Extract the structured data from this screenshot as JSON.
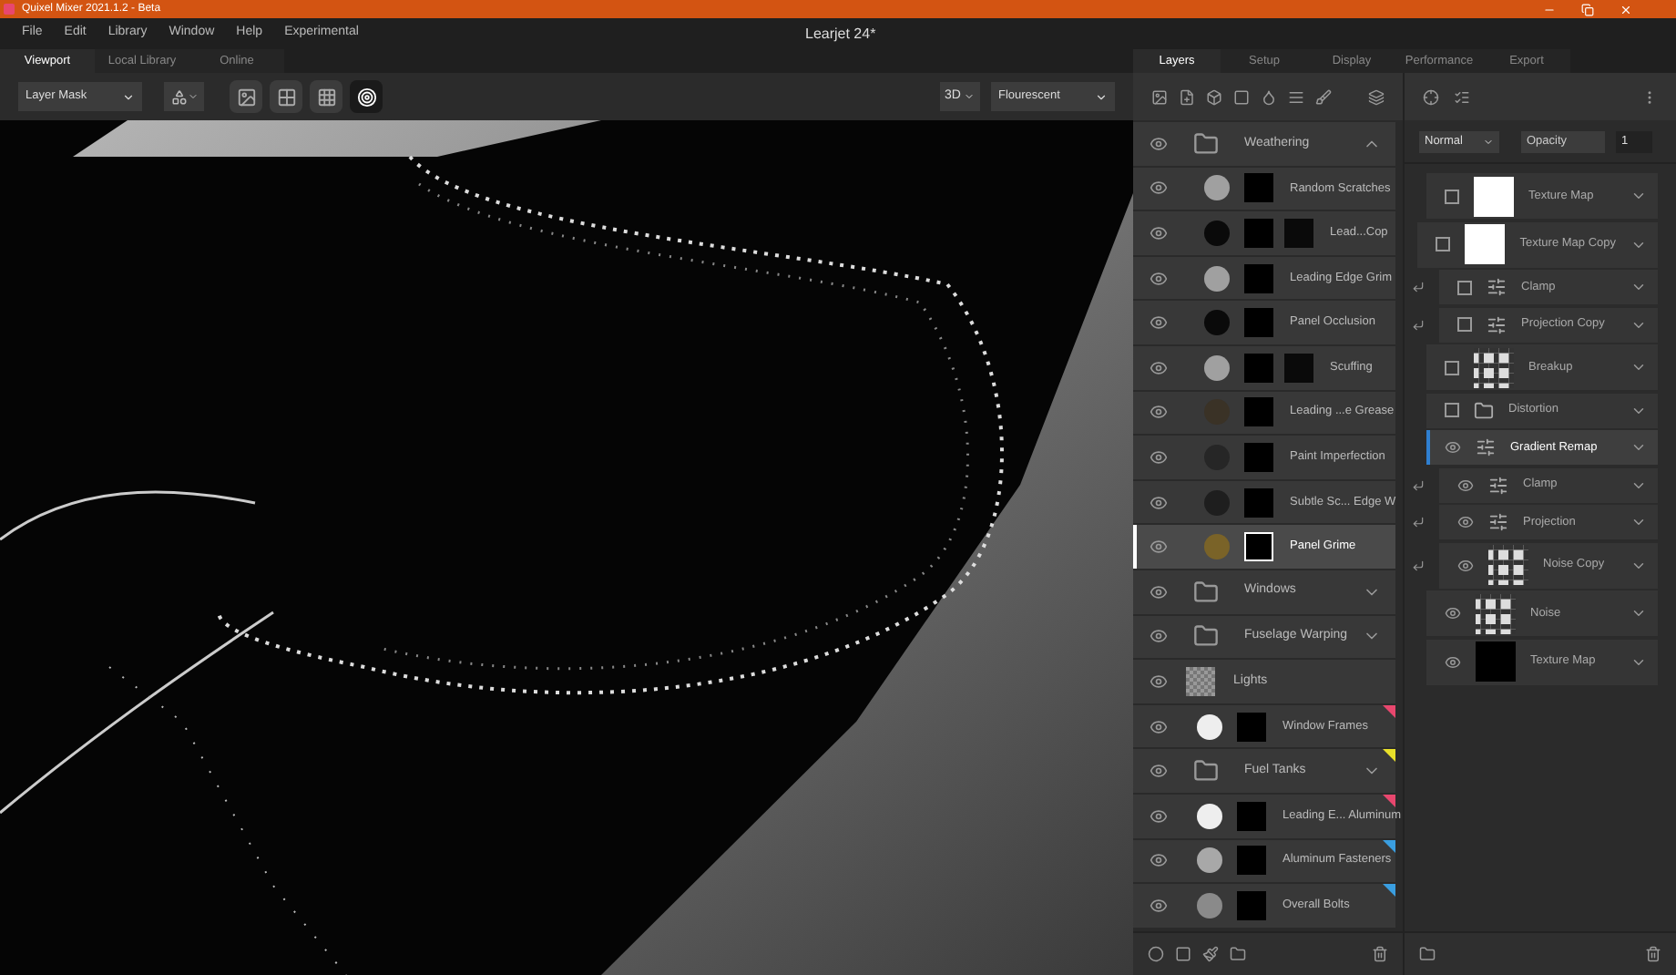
{
  "window": {
    "title": "Quixel Mixer 2021.1.2 - Beta",
    "document": "Learjet 24*"
  },
  "menu": [
    "File",
    "Edit",
    "Library",
    "Window",
    "Help",
    "Experimental"
  ],
  "left_tabs": [
    {
      "label": "Viewport",
      "selected": true
    },
    {
      "label": "Local Library",
      "selected": false
    },
    {
      "label": "Online",
      "selected": false
    }
  ],
  "toolbar": {
    "mode": "Layer Mask",
    "view": "3D",
    "lighting": "Flourescent"
  },
  "panel_tabs": [
    {
      "label": "Layers",
      "selected": true
    },
    {
      "label": "Setup",
      "selected": false
    },
    {
      "label": "Display",
      "selected": false
    },
    {
      "label": "Performance",
      "selected": false
    },
    {
      "label": "Export",
      "selected": false
    }
  ],
  "layers": [
    {
      "kind": "folder",
      "name": "Weathering",
      "expanded": true,
      "selected": false,
      "children": [
        {
          "kind": "layer",
          "name": "Random Scratches",
          "color": "#a0a0a0",
          "mask": false,
          "selected": false
        },
        {
          "kind": "layer",
          "name": "Lead...Cop",
          "color": "#0a0a0a",
          "mask": true,
          "selected": false
        },
        {
          "kind": "layer",
          "name": "Leading Edge Grim",
          "color": "#a0a0a0",
          "mask": false,
          "selected": false
        },
        {
          "kind": "layer",
          "name": "Panel Occlusion",
          "color": "#0a0a0a",
          "mask": false,
          "selected": false
        },
        {
          "kind": "layer",
          "name": "Scuffing",
          "color": "#a0a0a0",
          "mask": true,
          "selected": false
        },
        {
          "kind": "layer",
          "name": "Leading ...e Grease",
          "color": "#3a3226",
          "mask": false,
          "selected": false
        },
        {
          "kind": "layer",
          "name": "Paint Imperfection",
          "color": "#262626",
          "mask": false,
          "selected": false
        },
        {
          "kind": "layer",
          "name": "Subtle Sc... Edge W",
          "color": "#1e1e1e",
          "mask": false,
          "selected": false
        },
        {
          "kind": "layer",
          "name": "Panel Grime",
          "color": "#7a6328",
          "mask": false,
          "selected": true
        }
      ]
    },
    {
      "kind": "folder",
      "name": "Windows",
      "expanded": false,
      "selected": false
    },
    {
      "kind": "folder",
      "name": "Fuselage Warping",
      "expanded": false,
      "selected": false
    },
    {
      "kind": "checker",
      "name": "Lights",
      "selected": false
    },
    {
      "kind": "layer",
      "name": "Window Frames",
      "color": "#eeeeee",
      "mask": false,
      "selected": false,
      "tag": {
        "color": "#e8476e"
      }
    },
    {
      "kind": "folder",
      "name": "Fuel Tanks",
      "expanded": false,
      "selected": false,
      "tag": {
        "color": "#e8e02a"
      }
    },
    {
      "kind": "layer",
      "name": "Leading E... Aluminum",
      "color": "#eeeeee",
      "mask": false,
      "selected": false,
      "tag": {
        "color": "#e8476e"
      }
    },
    {
      "kind": "layer",
      "name": "Aluminum Fasteners",
      "color": "#a8a8a8",
      "mask": false,
      "selected": false,
      "tag": {
        "color": "#3a9ee0"
      }
    },
    {
      "kind": "layer",
      "name": "Overall Bolts",
      "color": "#8a8a8a",
      "mask": false,
      "selected": false,
      "tag": {
        "color": "#3a9ee0"
      }
    }
  ],
  "properties": {
    "blend": "Normal",
    "opacity_label": "Opacity",
    "opacity": "1"
  },
  "modifiers": [
    {
      "kind": "solid",
      "name": "Texture Map",
      "visible": false,
      "clipped": false,
      "selected": false
    },
    {
      "kind": "solid",
      "name": "Texture Map Copy",
      "visible": false,
      "clipped": false,
      "selected": false
    },
    {
      "kind": "adjustment",
      "name": "Clamp",
      "visible": false,
      "clipped": true,
      "selected": false
    },
    {
      "kind": "adjustment",
      "name": "Projection Copy",
      "visible": false,
      "clipped": true,
      "selected": false
    },
    {
      "kind": "noise",
      "name": "Breakup",
      "visible": false,
      "clipped": false,
      "selected": false
    },
    {
      "kind": "folder",
      "name": "Distortion",
      "visible": false,
      "clipped": false,
      "selected": false
    },
    {
      "kind": "adjustment",
      "name": "Gradient Remap",
      "visible": true,
      "clipped": false,
      "selected": true
    },
    {
      "kind": "adjustment",
      "name": "Clamp",
      "visible": true,
      "clipped": true,
      "selected": false
    },
    {
      "kind": "adjustment",
      "name": "Projection",
      "visible": true,
      "clipped": true,
      "selected": false
    },
    {
      "kind": "noise",
      "name": "Noise Copy",
      "visible": true,
      "clipped": true,
      "selected": false
    },
    {
      "kind": "noise",
      "name": "Noise",
      "visible": true,
      "clipped": false,
      "selected": false
    },
    {
      "kind": "dark",
      "name": "Texture Map",
      "visible": true,
      "clipped": false,
      "selected": false
    }
  ]
}
